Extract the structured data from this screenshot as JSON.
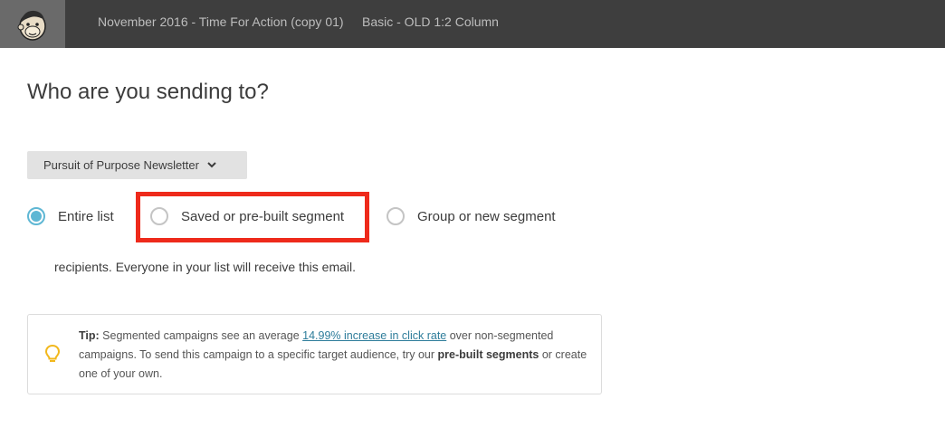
{
  "topbar": {
    "campaign_title": "November 2016 - Time For Action (copy 01)",
    "template_name": "Basic - OLD 1:2 Column",
    "logo_icon": "mailchimp-logo-icon"
  },
  "page": {
    "heading": "Who are you sending to?"
  },
  "list_selector": {
    "selected": "Pursuit of Purpose Newsletter",
    "icon": "chevron-down-icon"
  },
  "recipient_options": [
    {
      "label": "Entire list",
      "checked": true
    },
    {
      "label": "Saved or pre-built segment",
      "checked": false,
      "highlighted": true
    },
    {
      "label": "Group or new segment",
      "checked": false
    }
  ],
  "recipients_text": "recipients. Everyone in your list will receive this email.",
  "tip": {
    "label": "Tip:",
    "text_before_link": " Segmented campaigns see an average ",
    "link_text": "14.99% increase in click rate",
    "text_after_link": " over non-segmented campaigns. To send this campaign to a specific target audience, try our ",
    "bold_text": "pre-built segments",
    "text_end": " or create one of your own.",
    "icon": "lightbulb-icon"
  },
  "colors": {
    "topbar": "#3e3e3e",
    "radio_accent": "#5fb7d4",
    "highlight": "#ee2a1b",
    "link": "#2d7c9a",
    "lightbulb": "#f2b81d"
  }
}
